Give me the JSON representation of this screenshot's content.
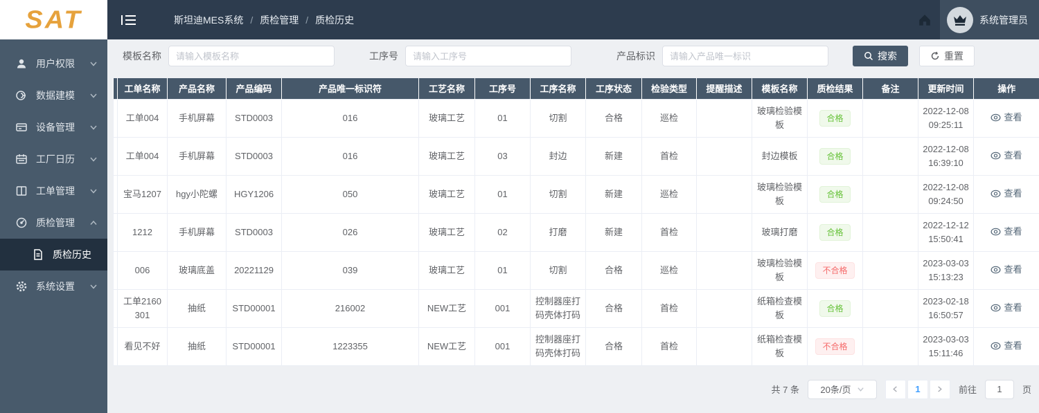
{
  "header": {
    "logo": "SAT",
    "breadcrumb": [
      "斯坦迪MES系统",
      "质检管理",
      "质检历史"
    ],
    "breadcrumb_separator": "/",
    "user_name": "系统管理员"
  },
  "sidebar": {
    "items": [
      {
        "label": "用户权限"
      },
      {
        "label": "数据建模"
      },
      {
        "label": "设备管理"
      },
      {
        "label": "工厂日历"
      },
      {
        "label": "工单管理"
      },
      {
        "label": "质检管理"
      },
      {
        "label": "质检历史"
      },
      {
        "label": "系统设置"
      }
    ]
  },
  "filters": [
    {
      "label": "模板名称",
      "placeholder": "请输入模板名称"
    },
    {
      "label": "工序号",
      "placeholder": "请输入工序号"
    },
    {
      "label": "产品标识",
      "placeholder": "请输入产品唯一标识"
    }
  ],
  "buttons": {
    "search": "搜索",
    "reset": "重置"
  },
  "table": {
    "columns": [
      "工单名称",
      "产品名称",
      "产品编码",
      "产品唯一标识符",
      "工艺名称",
      "工序号",
      "工序名称",
      "工序状态",
      "检验类型",
      "提醒描述",
      "模板名称",
      "质检结果",
      "备注",
      "更新时间",
      "操作"
    ],
    "rows": [
      {
        "work_order": "工单004",
        "product_name": "手机屏幕",
        "product_code": "STD0003",
        "product_uid": "016",
        "process_name": "玻璃工艺",
        "step_no": "01",
        "step_name": "切割",
        "step_status": "合格",
        "inspect_type": "巡检",
        "remind_desc": "",
        "template_name": "玻璃检验模板",
        "qc_result": "合格",
        "qc_result_type": "success",
        "remark": "",
        "updated": "2022-12-08 09:25:11",
        "action": "查看"
      },
      {
        "work_order": "工单004",
        "product_name": "手机屏幕",
        "product_code": "STD0003",
        "product_uid": "016",
        "process_name": "玻璃工艺",
        "step_no": "03",
        "step_name": "封边",
        "step_status": "新建",
        "inspect_type": "首检",
        "remind_desc": "",
        "template_name": "封边模板",
        "qc_result": "合格",
        "qc_result_type": "success",
        "remark": "",
        "updated": "2022-12-08 16:39:10",
        "action": "查看"
      },
      {
        "work_order": "宝马1207",
        "product_name": "hgy小陀螺",
        "product_code": "HGY1206",
        "product_uid": "050",
        "process_name": "玻璃工艺",
        "step_no": "01",
        "step_name": "切割",
        "step_status": "新建",
        "inspect_type": "巡检",
        "remind_desc": "",
        "template_name": "玻璃检验模板",
        "qc_result": "合格",
        "qc_result_type": "success",
        "remark": "",
        "updated": "2022-12-08 09:24:50",
        "action": "查看"
      },
      {
        "work_order": "1212",
        "product_name": "手机屏幕",
        "product_code": "STD0003",
        "product_uid": "026",
        "process_name": "玻璃工艺",
        "step_no": "02",
        "step_name": "打磨",
        "step_status": "新建",
        "inspect_type": "首检",
        "remind_desc": "",
        "template_name": "玻璃打磨",
        "qc_result": "合格",
        "qc_result_type": "success",
        "remark": "",
        "updated": "2022-12-12 15:50:41",
        "action": "查看"
      },
      {
        "work_order": "006",
        "product_name": "玻璃底盖",
        "product_code": "20221129",
        "product_uid": "039",
        "process_name": "玻璃工艺",
        "step_no": "01",
        "step_name": "切割",
        "step_status": "合格",
        "inspect_type": "巡检",
        "remind_desc": "",
        "template_name": "玻璃检验模板",
        "qc_result": "不合格",
        "qc_result_type": "danger",
        "remark": "",
        "updated": "2023-03-03 15:13:23",
        "action": "查看"
      },
      {
        "work_order": "工单2160301",
        "product_name": "抽纸",
        "product_code": "STD00001",
        "product_uid": "216002",
        "process_name": "NEW工艺",
        "step_no": "001",
        "step_name": "控制器座打码壳体打码",
        "step_status": "合格",
        "inspect_type": "首检",
        "remind_desc": "",
        "template_name": "纸箱检查模板",
        "qc_result": "合格",
        "qc_result_type": "success",
        "remark": "",
        "updated": "2023-02-18 16:50:57",
        "action": "查看"
      },
      {
        "work_order": "看见不好",
        "product_name": "抽纸",
        "product_code": "STD00001",
        "product_uid": "1223355",
        "process_name": "NEW工艺",
        "step_no": "001",
        "step_name": "控制器座打码壳体打码",
        "step_status": "合格",
        "inspect_type": "首检",
        "remind_desc": "",
        "template_name": "纸箱检查模板",
        "qc_result": "不合格",
        "qc_result_type": "danger",
        "remark": "",
        "updated": "2023-03-03 15:11:46",
        "action": "查看"
      }
    ]
  },
  "pagination": {
    "total": "共 7 条",
    "page_size": "20条/页",
    "page": "1",
    "goto_label": "前往",
    "goto_value": "1",
    "page_suffix": "页"
  }
}
